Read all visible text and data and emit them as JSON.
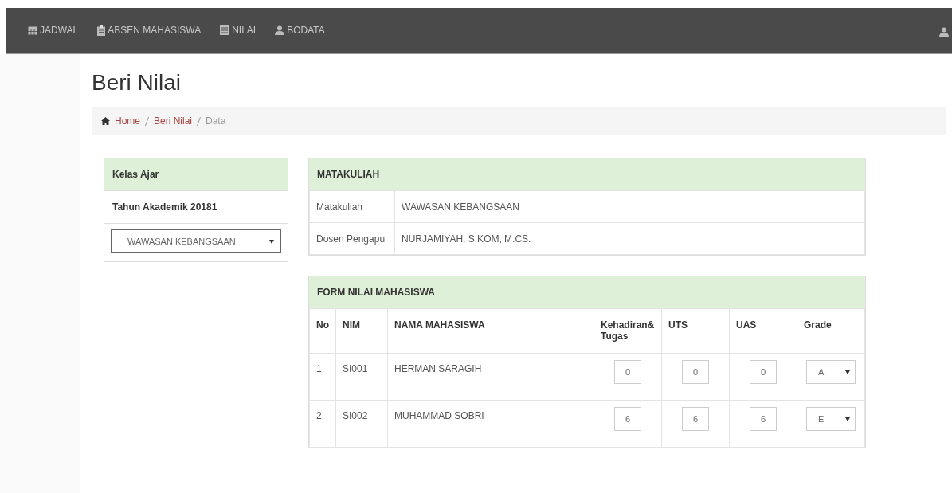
{
  "navbar": {
    "items": [
      {
        "label": "JADWAL"
      },
      {
        "label": "ABSEN MAHASISWA"
      },
      {
        "label": "NILAI"
      },
      {
        "label": "BODATA"
      }
    ]
  },
  "page_title": "Beri Nilai",
  "breadcrumb": [
    {
      "label": "Home",
      "kind": "link"
    },
    {
      "label": "Beri Nilai",
      "kind": "link"
    },
    {
      "label": "Data",
      "kind": "current"
    }
  ],
  "kelas_panel": {
    "heading": "Kelas Ajar",
    "subheading": "Tahun Akademik 20181",
    "select_value": "WAWASAN KEBANGSAAN"
  },
  "matakuliah_panel": {
    "heading": "MATAKULIAH",
    "rows": [
      {
        "label": "Matakuliah",
        "value": "WAWASAN KEBANGSAAN"
      },
      {
        "label": "Dosen Pengapu",
        "value": "NURJAMIYAH, S.KOM, M.CS."
      }
    ]
  },
  "form_panel": {
    "heading": "FORM NILAI MAHASISWA",
    "columns": [
      "No",
      "NIM",
      "NAMA MAHASISWA",
      "Kehadiran& Tugas",
      "UTS",
      "UAS",
      "Grade"
    ],
    "rows": [
      {
        "no": "1",
        "nim": "SI001",
        "nama": "HERMAN SARAGIH",
        "kehadiran": "0",
        "uts": "0",
        "uas": "0",
        "grade": "A"
      },
      {
        "no": "2",
        "nim": "SI002",
        "nama": "MUHAMMAD SOBRI",
        "kehadiran": "6",
        "uts": "6",
        "uas": "6",
        "grade": "E"
      }
    ]
  }
}
